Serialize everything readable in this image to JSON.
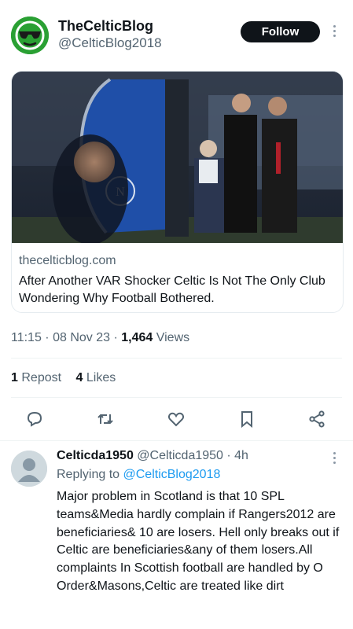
{
  "tweet": {
    "display_name": "TheCelticBlog",
    "handle": "@CelticBlog2018",
    "follow_label": "Follow",
    "link_card": {
      "domain": "thecelticblog.com",
      "title": "After Another VAR Shocker Celtic Is Not The Only Club Wondering Why Football Bothered."
    },
    "time": "11:15",
    "date": "08 Nov 23",
    "views_count": "1,464",
    "views_label": "Views",
    "reposts_count": "1",
    "reposts_label": "Repost",
    "likes_count": "4",
    "likes_label": "Likes"
  },
  "reply": {
    "display_name": "Celticda1950",
    "handle": "@Celticda1950",
    "age": "4h",
    "replying_prefix": "Replying to",
    "replying_to": "@CelticBlog2018",
    "text": "Major problem in Scotland is that 10 SPL teams&Media hardly complain if Rangers2012 are beneficiaries& 10 are losers. Hell only breaks out if Celtic are beneficiaries&any of them losers.All complaints In Scottish football are handled by O Order&Masons,Celtic are treated like dirt"
  },
  "colors": {
    "brand_green": "#2aa033",
    "link_blue": "#1d9bf0",
    "muted": "#536471"
  },
  "icons": [
    "sunglasses-avatar-icon",
    "more-icon",
    "reply-icon",
    "repost-icon",
    "like-icon",
    "bookmark-icon",
    "share-icon",
    "default-avatar-icon"
  ]
}
